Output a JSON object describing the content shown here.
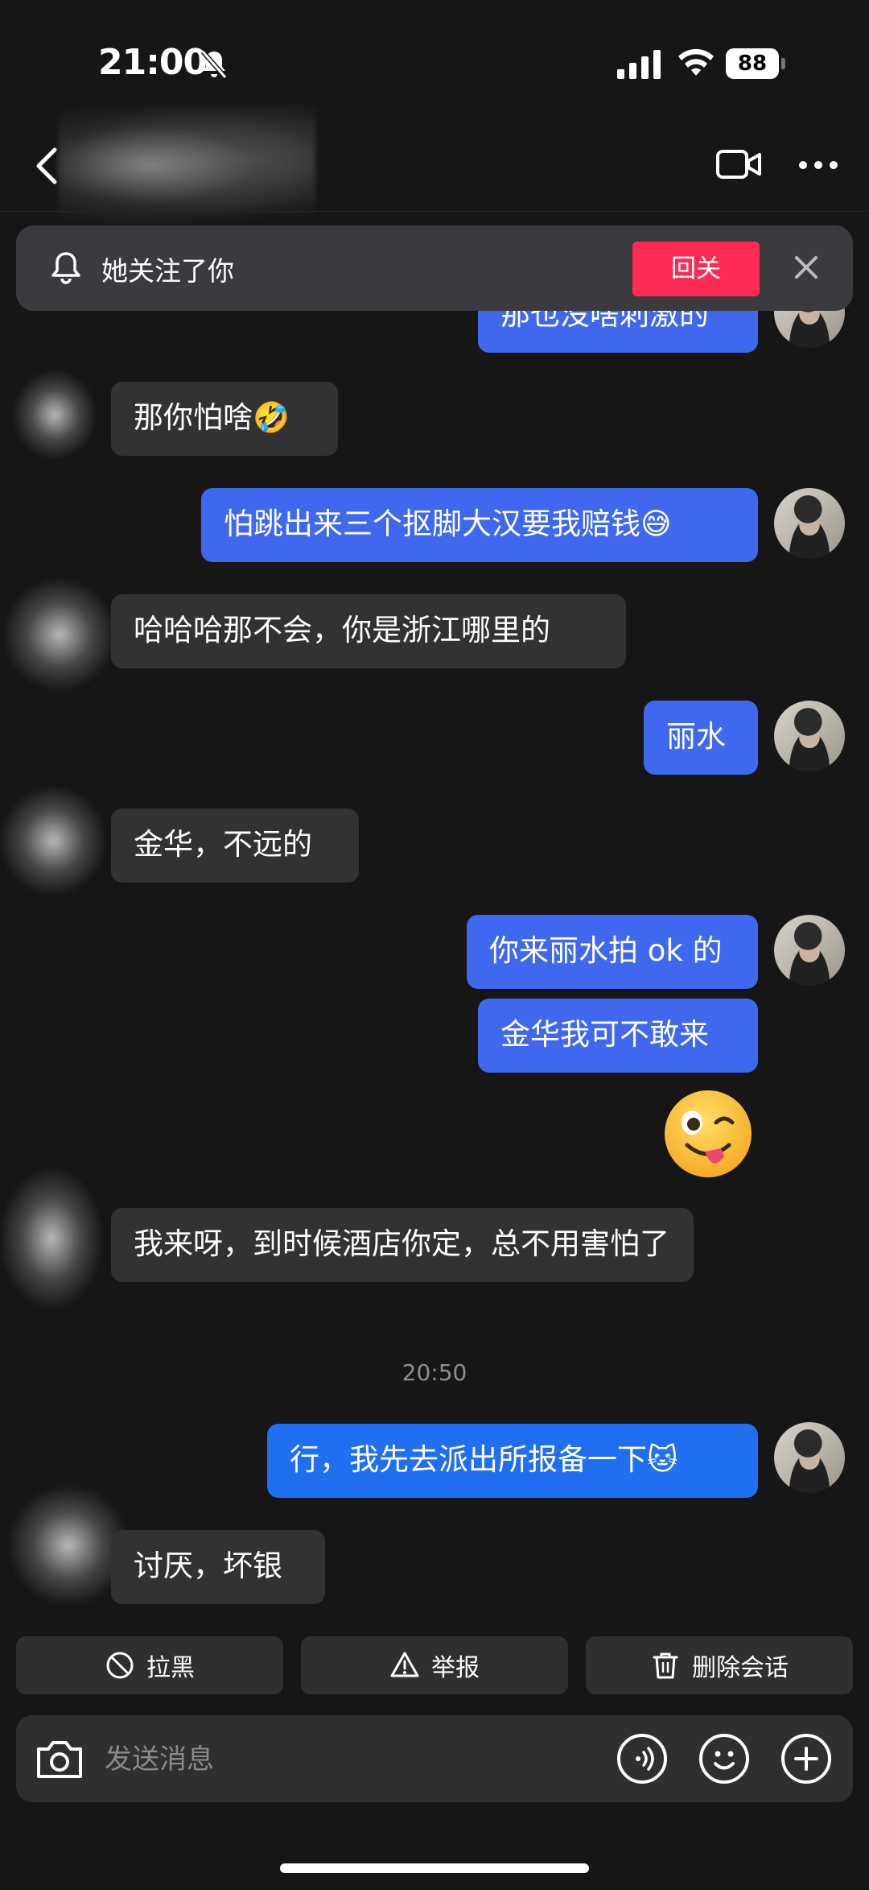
{
  "status_bar": {
    "time": "21:00",
    "battery": "88"
  },
  "banner": {
    "text": "她关注了你",
    "follow_back": "回关"
  },
  "messages": {
    "m0": "那也没啥刺激的",
    "m1": "那你怕啥🤣",
    "m2": "怕跳出来三个抠脚大汉要我赔钱😅",
    "m3": "哈哈哈那不会，你是浙江哪里的",
    "m4": "丽水",
    "m5": "金华，不远的",
    "m6": "你来丽水拍 ok 的",
    "m7": "金华我可不敢来",
    "m9": "我来呀，到时候酒店你定，总不用害怕了",
    "time": "20:50",
    "m10": "行，我先去派出所报备一下🐱",
    "m11": "讨厌，坏银"
  },
  "actions": {
    "block": "拉黑",
    "report": "举报",
    "delete": "删除会话"
  },
  "input": {
    "placeholder": "发送消息"
  },
  "icons": {
    "bell_off": "bell-off-icon",
    "back": "back-arrow-icon",
    "video": "video-camera-icon",
    "more": "more-icon",
    "bell": "bell-icon",
    "close": "close-icon",
    "ban": "ban-icon",
    "warning": "warning-icon",
    "trash": "trash-icon",
    "camera": "camera-icon",
    "voice": "voice-icon",
    "sticker": "emoji-icon",
    "plus": "plus-icon",
    "wink": "winking-tongue-emoji"
  },
  "colors": {
    "background": "#161616",
    "my_bubble": "#3f68ef",
    "their_bubble": "#323234",
    "follow_button": "#fe2c55"
  }
}
